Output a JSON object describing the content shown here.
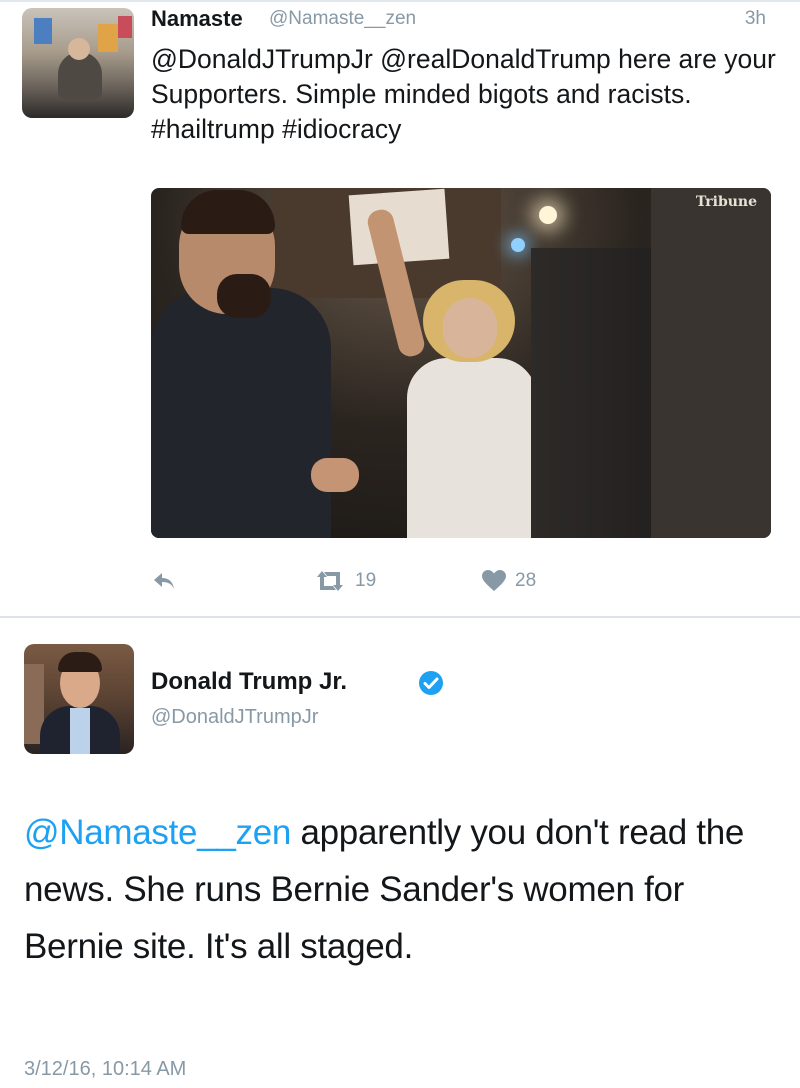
{
  "tweet1": {
    "author_name": "Namaste",
    "author_handle": "@Namaste__zen",
    "time": "3h",
    "text": "@DonaldJTrumpJr @realDonaldTrump here are your Supporters. Simple minded bigots and racists. #hailtrump #idiocracy",
    "media_watermark": "Tribune",
    "retweet_count": "19",
    "like_count": "28"
  },
  "tweet2": {
    "author_name": "Donald Trump Jr.",
    "author_handle": "@DonaldJTrumpJr",
    "mention": "@Namaste__zen",
    "text": " apparently you don't read the news. She runs Bernie Sander's women for Bernie site. It's all staged.",
    "timestamp": "3/12/16, 10:14 AM"
  },
  "colors": {
    "link": "#1da1f2",
    "muted": "#8899a6",
    "verified": "#1da1f2"
  },
  "icons": [
    "reply-icon",
    "retweet-icon",
    "like-icon",
    "verified-badge-icon"
  ]
}
